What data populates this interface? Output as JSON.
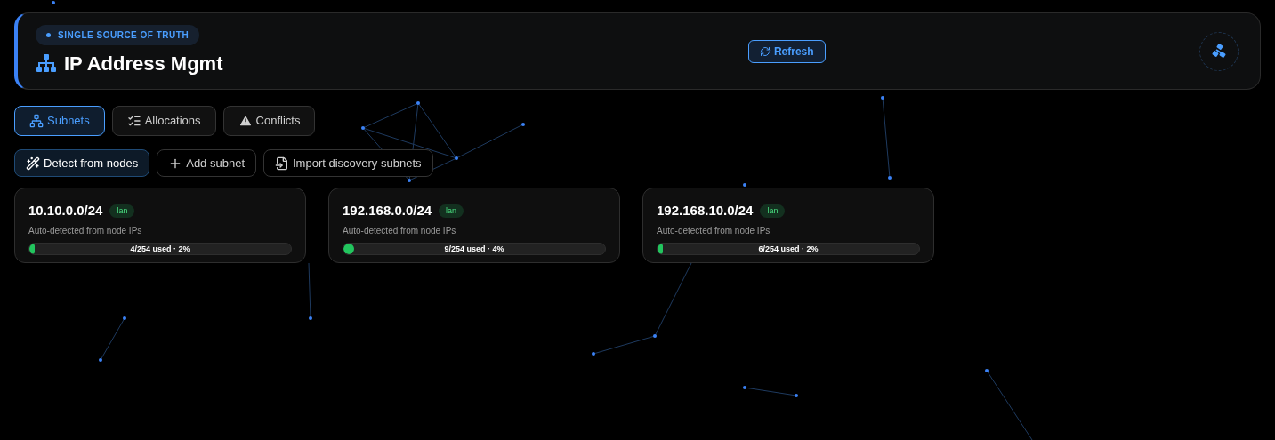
{
  "header": {
    "badge": "SINGLE SOURCE OF TRUTH",
    "title": "IP Address Mgmt",
    "refresh_button": "Refresh"
  },
  "tabs": [
    {
      "label": "Subnets",
      "selected": true
    },
    {
      "label": "Allocations",
      "selected": false
    },
    {
      "label": "Conflicts",
      "selected": false
    }
  ],
  "actions": [
    {
      "label": "Detect from nodes",
      "kind": "primary"
    },
    {
      "label": "Add subnet",
      "kind": "plain"
    },
    {
      "label": "Import discovery subnets",
      "kind": "plain"
    }
  ],
  "subnets": [
    {
      "cidr": "10.10.0.0/24",
      "tag": "lan",
      "description": "Auto-detected from node IPs",
      "usage": "4/254 used · 2%",
      "level": 0.02
    },
    {
      "cidr": "192.168.0.0/24",
      "tag": "lan",
      "description": "Auto-detected from node IPs",
      "usage": "9/254 used · 4%",
      "level": 0.04
    },
    {
      "cidr": "192.168.10.0/24",
      "tag": "lan",
      "description": "Auto-detected from node IPs",
      "usage": "6/254 used · 2%",
      "level": 0.02
    }
  ]
}
